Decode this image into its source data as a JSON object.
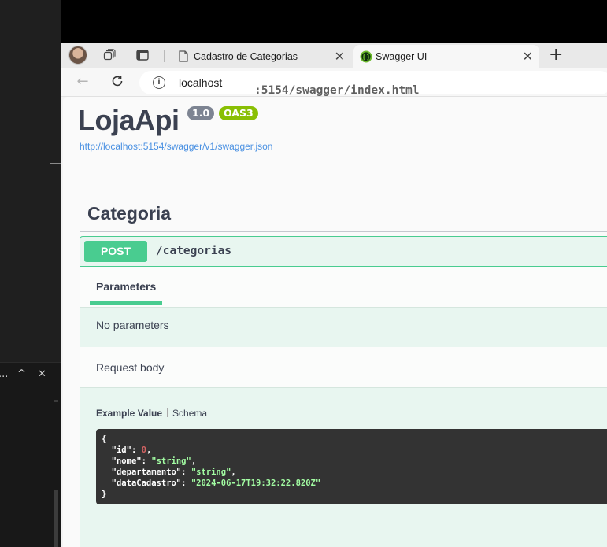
{
  "browser": {
    "tabs": [
      {
        "title": "Cadastro de Categorias",
        "active": false
      },
      {
        "title": "Swagger UI",
        "active": true
      }
    ],
    "tab_close_glyph": "✕",
    "new_tab_glyph": "+",
    "url_host": "localhost",
    "url_path": ":5154/swagger/index.html",
    "icons": [
      "profile-avatar",
      "workspaces-icon",
      "tab-actions-icon",
      "page-icon",
      "swagger-favicon",
      "back-icon",
      "refresh-icon",
      "info-icon"
    ]
  },
  "editor": {
    "panel_controls": [
      "...",
      "^",
      "✕"
    ]
  },
  "swagger": {
    "title": "LojaApi",
    "version": "1.0",
    "oas": "OAS3",
    "spec_url": "http://localhost:5154/swagger/v1/swagger.json",
    "section": "Categoria",
    "operation": {
      "method": "POST",
      "path": "/categorias",
      "parameters_tab": "Parameters",
      "no_parameters": "No parameters",
      "request_body": "Request body",
      "example_value_tab": "Example Value",
      "schema_tab": "Schema",
      "example": {
        "id": "0",
        "nome": "\"string\"",
        "departamento": "\"string\"",
        "dataCadastro": "\"2024-06-17T19:32:22.820Z\""
      }
    }
  },
  "colors": {
    "post": "#49cc90",
    "post_bg": "#e8f6f0",
    "title": "#3b4151",
    "badge_version": "#7d8492",
    "badge_oas": "#89bf04",
    "link": "#4990e2",
    "code_bg": "#333333"
  }
}
